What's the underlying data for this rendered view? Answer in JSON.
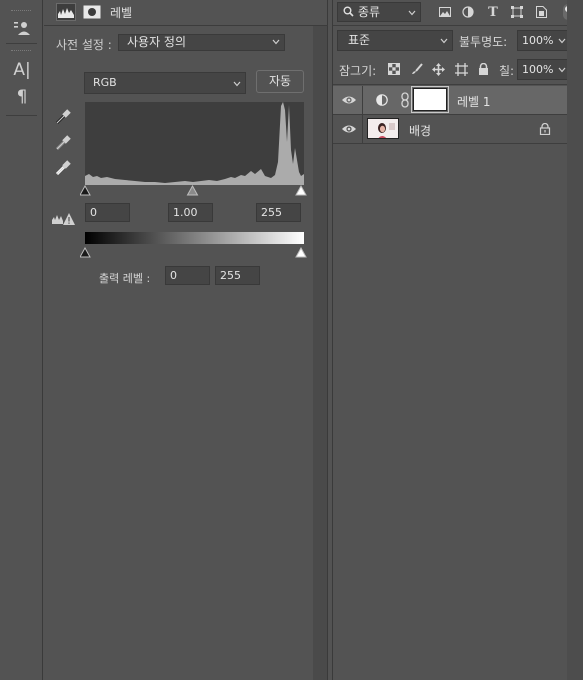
{
  "tools": [
    {
      "name": "bank-icon"
    },
    {
      "name": "character-panel-icon",
      "glyph": "A|"
    },
    {
      "name": "paragraph-icon",
      "glyph": "¶"
    }
  ],
  "properties": {
    "title": "레벨",
    "preset_label": "사전 설정 :",
    "preset_value": "사용자 정의",
    "channel": "RGB",
    "auto_label": "자동",
    "input_black": "0",
    "input_gamma": "1.00",
    "input_white": "255",
    "output_label": "출력 레벨 :",
    "output_black": "0",
    "output_white": "255"
  },
  "layers": {
    "filter_label": "종류",
    "blend_mode": "표준",
    "opacity_label": "불투명도:",
    "opacity_value": "100%",
    "lock_label": "잠그기:",
    "fill_label": "칠:",
    "fill_value": "100%",
    "items": [
      {
        "name": "레벨 1",
        "selected": true,
        "visible": true,
        "type": "levels-adjustment"
      },
      {
        "name": "배경",
        "selected": false,
        "visible": true,
        "type": "image",
        "locked": true
      }
    ]
  },
  "colors": {
    "panel_bg": "#535353",
    "field_bg": "#454545",
    "selected_row": "#676767"
  }
}
